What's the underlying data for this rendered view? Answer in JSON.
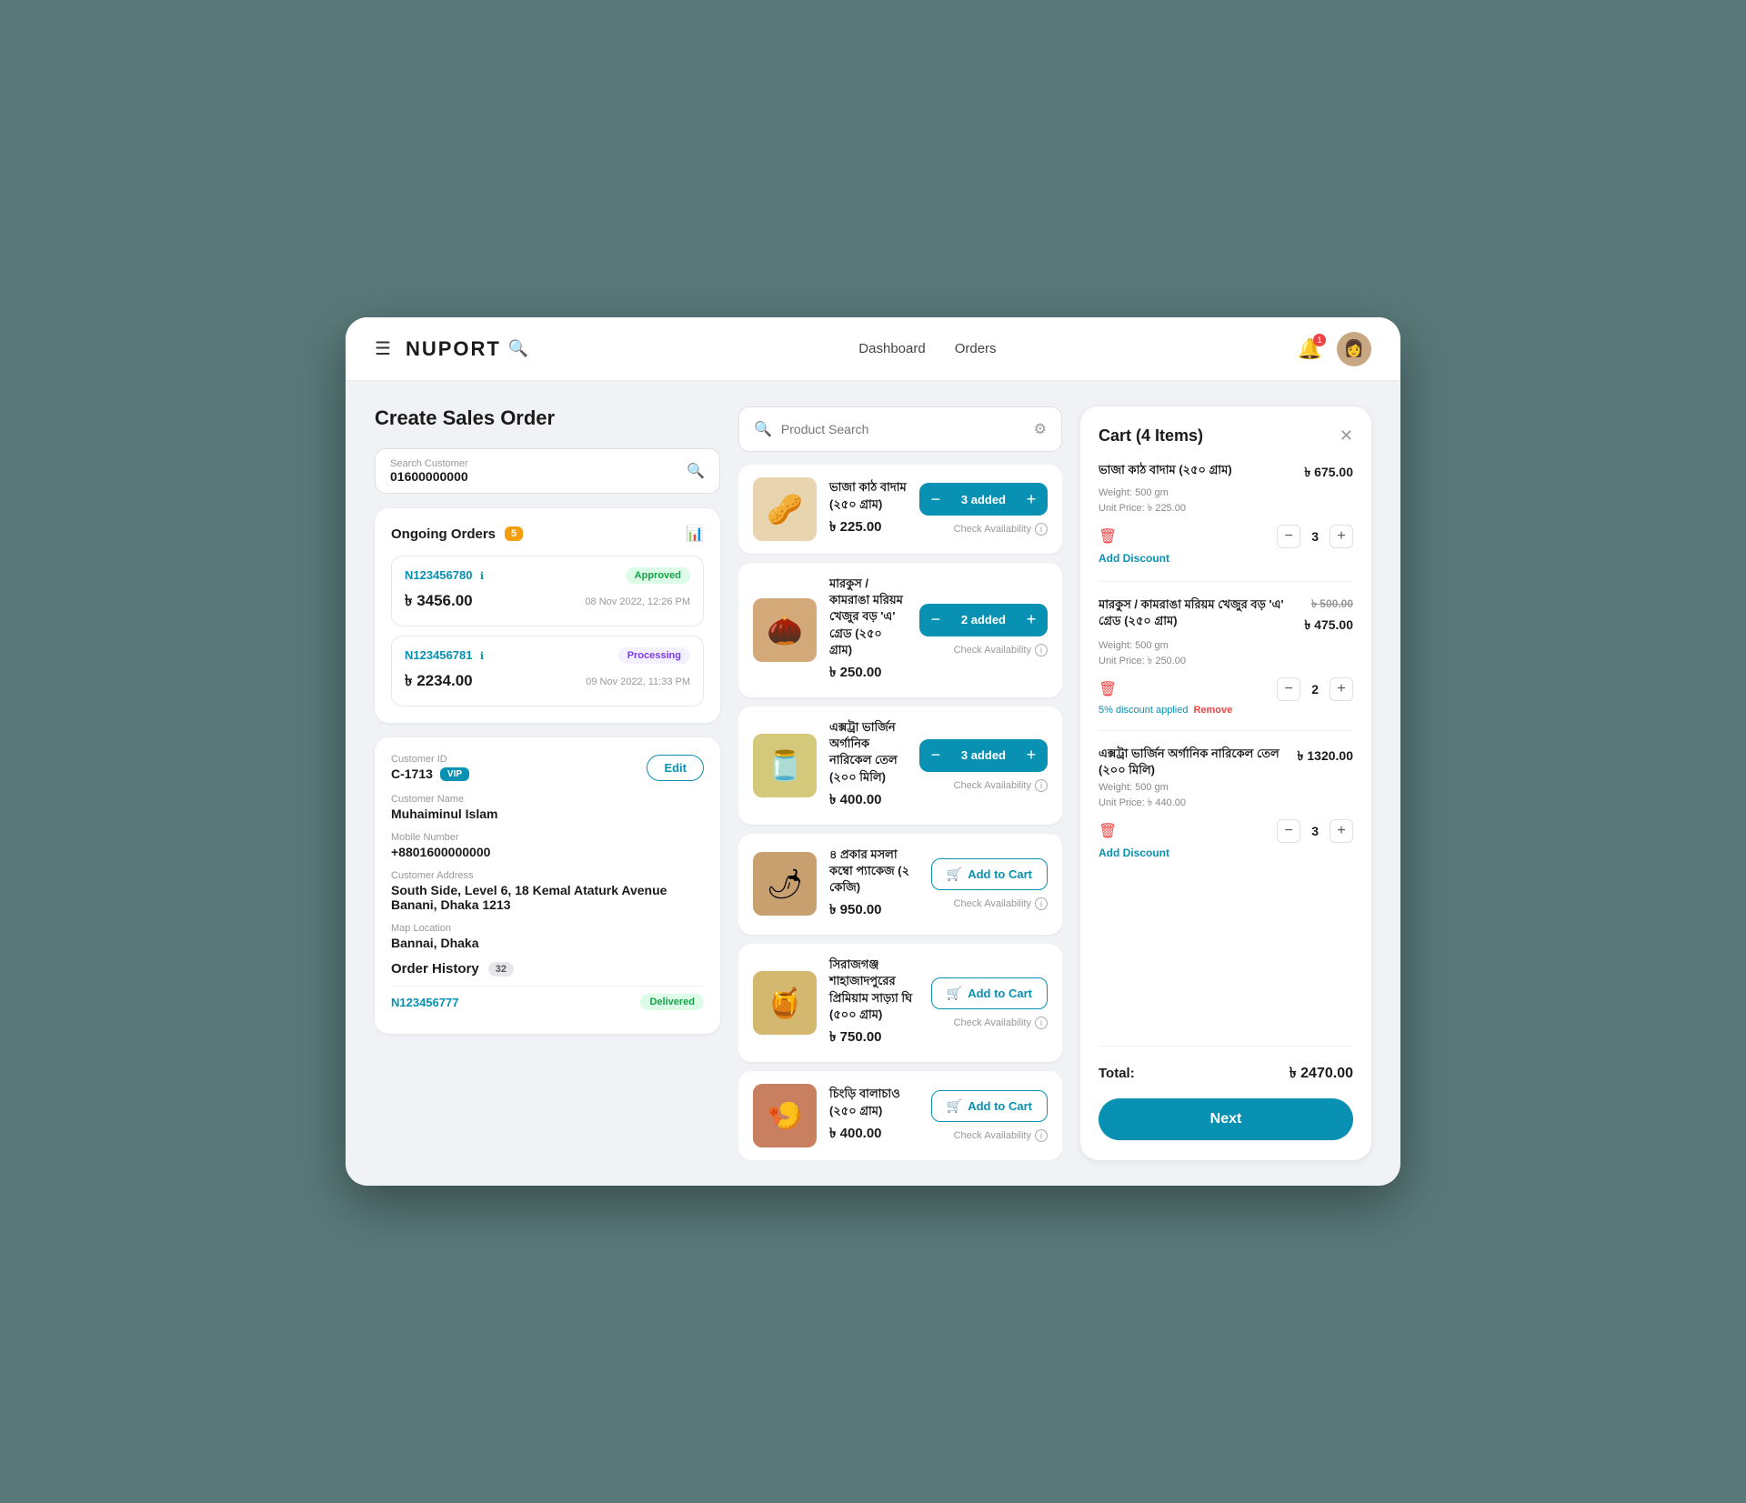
{
  "app": {
    "logo": "NUPORT",
    "nav_links": [
      "Dashboard",
      "Orders"
    ],
    "bell_badge": "1"
  },
  "page": {
    "title": "Create Sales Order"
  },
  "customer_search": {
    "label": "Search Customer",
    "value": "01600000000",
    "placeholder": "Search Customer"
  },
  "product_search": {
    "placeholder": "Product Search"
  },
  "ongoing_orders": {
    "label": "Ongoing Orders",
    "count": "5",
    "items": [
      {
        "id": "N123456780",
        "status": "Approved",
        "status_key": "approved",
        "amount": "৳ 3456.00",
        "date": "08 Nov 2022, 12:26 PM"
      },
      {
        "id": "N123456781",
        "status": "Processing",
        "status_key": "processing",
        "amount": "৳ 2234.00",
        "date": "09 Nov 2022, 11:33 PM"
      }
    ]
  },
  "customer": {
    "id_label": "Customer ID",
    "id_value": "C-1713",
    "vip": "VIP",
    "edit_label": "Edit",
    "name_label": "Customer Name",
    "name_value": "Muhaiminul Islam",
    "mobile_label": "Mobile Number",
    "mobile_value": "+8801600000000",
    "address_label": "Customer Address",
    "address_value": "South Side, Level 6, 18 Kemal Ataturk Avenue Banani, Dhaka 1213",
    "map_label": "Map Location",
    "map_value": "Bannai, Dhaka"
  },
  "order_history": {
    "label": "Order History",
    "count": "32",
    "items": [
      {
        "id": "N123456777",
        "status": "Delivered",
        "status_key": "delivered"
      }
    ]
  },
  "products": [
    {
      "name": "ভাজা কাঠ বাদাম (২৫০ গ্রাম)",
      "price": "৳ 225.00",
      "emoji": "🥜",
      "bg": "#e8d5b0",
      "state": "added",
      "qty": "3 added"
    },
    {
      "name": "মারকুস / কামরাঙা মরিয়ম খেজুর বড় 'এ' গ্রেড (২৫০ গ্রাম)",
      "price": "৳ 250.00",
      "emoji": "🌰",
      "bg": "#d4a97a",
      "state": "added",
      "qty": "2 added"
    },
    {
      "name": "এক্সট্রা ভার্জিন অর্গানিক নারিকেল তেল (২০০ মিলি)",
      "price": "৳ 400.00",
      "emoji": "🫙",
      "bg": "#d4c87a",
      "state": "added",
      "qty": "3 added"
    },
    {
      "name": "৪ প্রকার মসলা কম্বো প্যাকেজ (২ কেজি)",
      "price": "৳ 950.00",
      "emoji": "🌶",
      "bg": "#c8a070",
      "state": "cart",
      "qty": ""
    },
    {
      "name": "সিরাজগঞ্জ শাহাজাদপুরের প্রিমিয়াম সাড়্যা ঘি (৫০০ গ্রাম)",
      "price": "৳ 750.00",
      "emoji": "🍯",
      "bg": "#d4b870",
      "state": "cart",
      "qty": ""
    },
    {
      "name": "চিংড়ি বালাচাও (২৫০ গ্রাম)",
      "price": "৳ 400.00",
      "emoji": "🍤",
      "bg": "#c88060",
      "state": "cart",
      "qty": ""
    }
  ],
  "add_to_cart_label": "Add to Cart",
  "check_availability_label": "Check Availability",
  "cart": {
    "title": "Cart (4 Items)",
    "items": [
      {
        "name": "ভাজা কাঠ বাদাম (২৫০ গ্রাম)",
        "weight": "Weight: 500 gm",
        "unit_price": "Unit Price: ৳ 225.00",
        "price": "৳ 675.00",
        "qty": "3",
        "has_discount": false,
        "add_discount_label": "Add Discount"
      },
      {
        "name": "মারকুস / কামরাঙা মরিয়ম খেজুর বড় 'এ' গ্রেড (২৫০ গ্রাম)",
        "weight": "Weight: 500 gm",
        "unit_price": "Unit Price: ৳ 250.00",
        "price": "৳ 475.00",
        "original_price": "৳ 500.00",
        "qty": "2",
        "has_discount": true,
        "discount_text": "5% discount applied",
        "remove_label": "Remove"
      },
      {
        "name": "এক্সট্রা ভার্জিন অর্গানিক নারিকেল তেল (২০০ মিলি)",
        "weight": "Weight: 500 gm",
        "unit_price": "Unit Price: ৳ 440.00",
        "price": "৳ 1320.00",
        "qty": "3",
        "has_discount": false,
        "add_discount_label": "Add Discount"
      }
    ],
    "total_label": "Total:",
    "total_amount": "৳ 2470.00",
    "next_label": "Next"
  }
}
